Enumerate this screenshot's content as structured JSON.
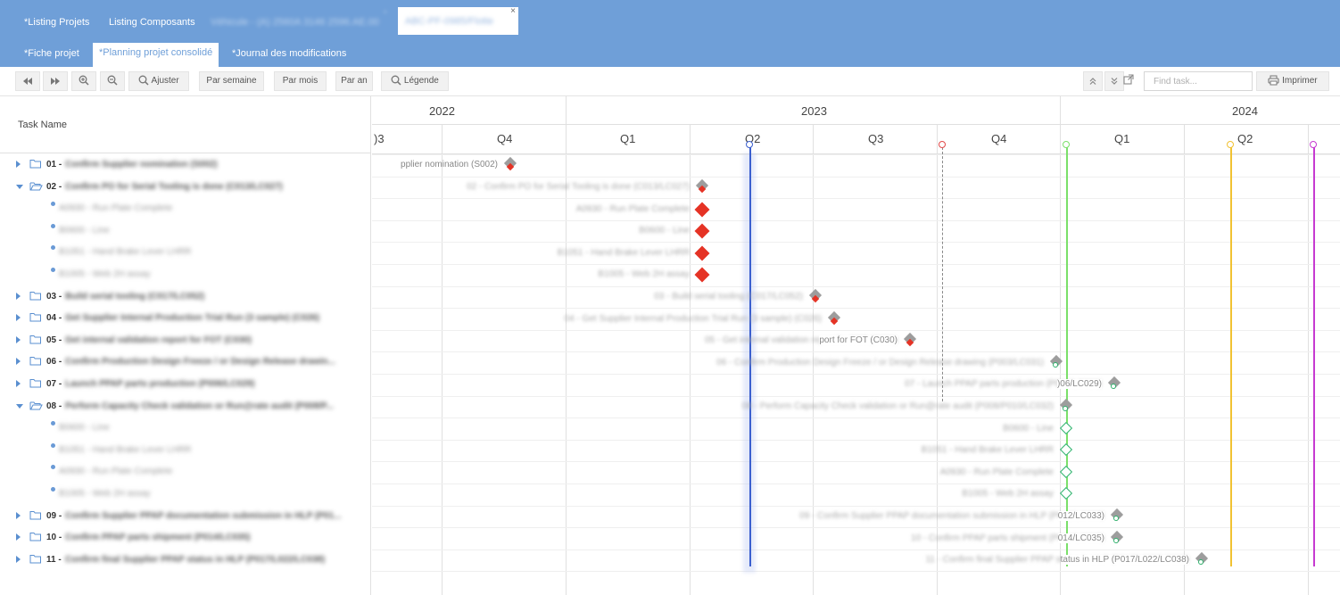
{
  "topbar": {
    "tabs_row1": [
      "*Listing Projets",
      "Listing Composants",
      "Véhicule - (A) 2560A 3146 2596.AE.00",
      "ABC-PF-0985/Flotte"
    ],
    "tabs_row2": [
      "*Fiche projet",
      "*Planning projet consolidé",
      "*Journal des modifications"
    ],
    "active_tab": "*Planning projet consolidé",
    "close_glyph": "×"
  },
  "toolbar": {
    "ajuster": "Ajuster",
    "par_semaine": "Par semaine",
    "par_mois": "Par mois",
    "par_an": "Par an",
    "legende": "Légende",
    "find_placeholder": "Find task...",
    "imprimer": "Imprimer",
    "icons": [
      "rewind-icon",
      "fast-forward-icon",
      "zoom-in-icon",
      "zoom-out-icon",
      "search-icon",
      "collapse-up-icon",
      "expand-down-icon",
      "external-link-icon",
      "printer-icon"
    ]
  },
  "grid": {
    "header": "Task Name",
    "rows": [
      {
        "type": "group",
        "expanded": false,
        "num": "01 -",
        "name": "Confirm Supplier nomination (S002)"
      },
      {
        "type": "group",
        "expanded": true,
        "num": "02 -",
        "name": "Confirm PO for Serial Tooling is done (C013/LC027)"
      },
      {
        "type": "child",
        "name": "A0930 - Run Plate Complete"
      },
      {
        "type": "child",
        "name": "B0600 - Line"
      },
      {
        "type": "child",
        "name": "B1051 - Hand Brake Lever LHRR"
      },
      {
        "type": "child",
        "name": "B1005 - Web 2H assay"
      },
      {
        "type": "group",
        "expanded": false,
        "num": "03 -",
        "name": "Build serial tooling (C017/LC052)"
      },
      {
        "type": "group",
        "expanded": false,
        "num": "04 -",
        "name": "Get Supplier Internal Production Trial Run (3 sample) (C026)"
      },
      {
        "type": "group",
        "expanded": false,
        "num": "05 -",
        "name": "Get internal validation report for FOT (C030)"
      },
      {
        "type": "group",
        "expanded": false,
        "num": "06 -",
        "name": "Confirm Production Design Freeze / or Design Release drawin..."
      },
      {
        "type": "group",
        "expanded": false,
        "num": "07 -",
        "name": "Launch PPAP parts production (P006/LC029)"
      },
      {
        "type": "group",
        "expanded": true,
        "num": "08 -",
        "name": "Perform Capacity Check validation or Run@rate audit (P008/P..."
      },
      {
        "type": "child",
        "name": "B0600 - Line"
      },
      {
        "type": "child",
        "name": "B1051 - Hand Brake Lever LHRR"
      },
      {
        "type": "child",
        "name": "A0930 - Run Plate Complete"
      },
      {
        "type": "child",
        "name": "B1005 - Web 2H assay"
      },
      {
        "type": "group",
        "expanded": false,
        "num": "09 -",
        "name": "Confirm Supplier PPAP documentation submission in HLP (P01..."
      },
      {
        "type": "group",
        "expanded": false,
        "num": "10 -",
        "name": "Confirm PPAP parts shipment (P014/LC035)"
      },
      {
        "type": "group",
        "expanded": false,
        "num": "11 -",
        "name": "Confirm final Supplier PPAP status in HLP (P017/L022/LC038)"
      }
    ]
  },
  "timeline": {
    "years": [
      "2022",
      "2023",
      "2024"
    ],
    "quarters": [
      "Q3",
      "Q4",
      "Q1",
      "Q2",
      "Q3",
      "Q4",
      "Q1",
      "Q2"
    ],
    "partial_quarter_label": ")3",
    "bar_labels": [
      "pplier nomination (S002)",
      "02 - Confirm PO for Serial Tooling is done (C013/LC027)",
      "A0930 - Run Plate Complete",
      "B0600 - Line",
      "B1051 - Hand Brake Lever LHRR",
      "B1005 - Web 2H assay",
      "03 - Build serial tooling (C017/LC052)",
      "04 - Get Supplier Internal Production Trial Run (3 sample) (C026)",
      "05 - Get internal validation report for FOT (C030)",
      "06 - Confirm Production Design Freeze / or Design Release drawing (P003/LC031)",
      "07 - Launch PPAP parts production (P006/LC029)",
      "08 - Perform Capacity Check validation or Run@rate audit (P008/P010/LC032)",
      "B0600 - Line",
      "B1051 - Hand Brake Lever LHRR",
      "A0930 - Run Plate Complete",
      "B1005 - Web 2H assay",
      "09 - Confirm Supplier PPAP documentation submission in HLP (P012/LC033)",
      "10 - Confirm PPAP parts shipment (P014/LC035)",
      "11 - Confirm final Supplier PPAP status in HLP (P017/L022/LC038)"
    ],
    "clear_label_suffixes": [
      "pplier nomination (S002)",
      "port for FOT (C030)",
      ")06/LC029)",
      "012/LC033)",
      "014/LC035)",
      "tatus in HLP (P017/L022/LC038)"
    ],
    "colors": {
      "late_marker": "#e53325",
      "group_marker": "#9d9d9d",
      "ok_marker": "#2fb36d",
      "today_line": "#3a5fcf",
      "marker_red": "#e24a4a",
      "marker_green": "#7be06a",
      "marker_yellow": "#f1c232",
      "marker_purple": "#c63ad1"
    }
  }
}
